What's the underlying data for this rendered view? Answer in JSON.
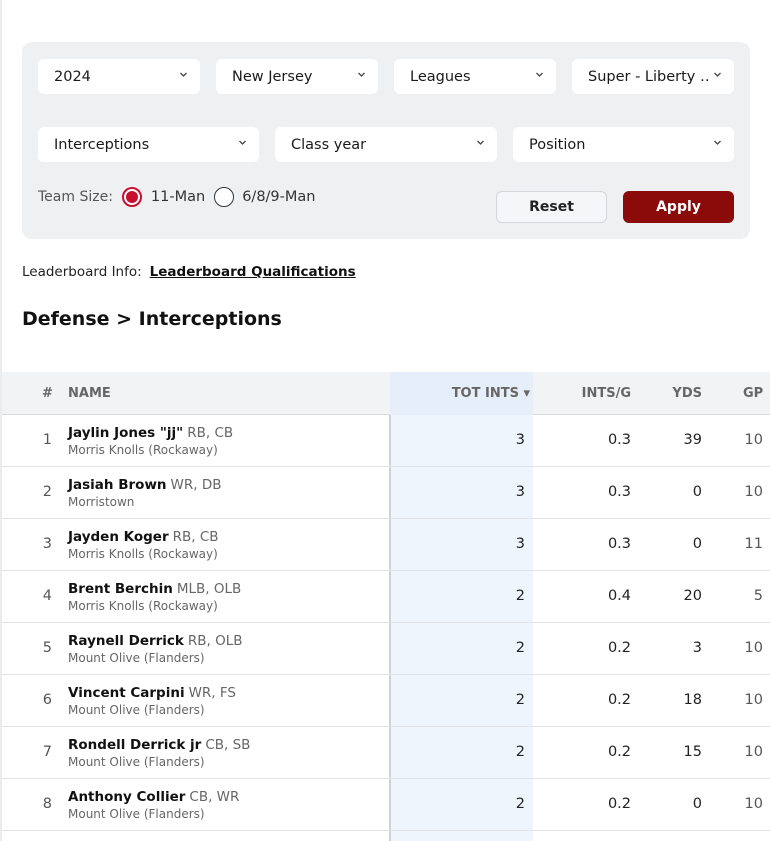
{
  "filters": {
    "year": "2024",
    "state": "New Jersey",
    "leagues": "Leagues",
    "conference": "Super - Liberty …",
    "stat": "Interceptions",
    "class_year": "Class year",
    "position": "Position"
  },
  "team_size": {
    "label": "Team Size:",
    "option_11": "11-Man",
    "option_689": "6/8/9-Man",
    "selected": "11-Man"
  },
  "buttons": {
    "reset": "Reset",
    "apply": "Apply"
  },
  "leaderboard_info": {
    "label": "Leaderboard Info:",
    "link": "Leaderboard Qualifications"
  },
  "section_title": "Defense > Interceptions",
  "table": {
    "headers": {
      "rank": "#",
      "name": "NAME",
      "tot_ints": "TOT INTS ▾",
      "ints_per_game": "INTS/G",
      "yds": "YDS",
      "gp": "GP"
    },
    "rows": [
      {
        "rank": "1",
        "name": "Jaylin Jones \"jj\"",
        "pos": "RB, CB",
        "school": "Morris Knolls (Rockaway)",
        "tot_ints": "3",
        "ints_per_game": "0.3",
        "yds": "39",
        "gp": "10"
      },
      {
        "rank": "2",
        "name": "Jasiah Brown",
        "pos": "WR, DB",
        "school": "Morristown",
        "tot_ints": "3",
        "ints_per_game": "0.3",
        "yds": "0",
        "gp": "10"
      },
      {
        "rank": "3",
        "name": "Jayden Koger",
        "pos": "RB, CB",
        "school": "Morris Knolls (Rockaway)",
        "tot_ints": "3",
        "ints_per_game": "0.3",
        "yds": "0",
        "gp": "11"
      },
      {
        "rank": "4",
        "name": "Brent Berchin",
        "pos": "MLB, OLB",
        "school": "Morris Knolls (Rockaway)",
        "tot_ints": "2",
        "ints_per_game": "0.4",
        "yds": "20",
        "gp": "5"
      },
      {
        "rank": "5",
        "name": "Raynell Derrick",
        "pos": "RB, OLB",
        "school": "Mount Olive (Flanders)",
        "tot_ints": "2",
        "ints_per_game": "0.2",
        "yds": "3",
        "gp": "10"
      },
      {
        "rank": "6",
        "name": "Vincent Carpini",
        "pos": "WR, FS",
        "school": "Mount Olive (Flanders)",
        "tot_ints": "2",
        "ints_per_game": "0.2",
        "yds": "18",
        "gp": "10"
      },
      {
        "rank": "7",
        "name": "Rondell Derrick jr",
        "pos": "CB, SB",
        "school": "Mount Olive (Flanders)",
        "tot_ints": "2",
        "ints_per_game": "0.2",
        "yds": "15",
        "gp": "10"
      },
      {
        "rank": "8",
        "name": "Anthony Collier",
        "pos": "CB, WR",
        "school": "Mount Olive (Flanders)",
        "tot_ints": "2",
        "ints_per_game": "0.2",
        "yds": "0",
        "gp": "10"
      }
    ]
  },
  "colors": {
    "accent": "#c8102e",
    "apply_bg": "#8b0a0a",
    "panel_bg": "#eef0f2",
    "sorted_col_bg": "#eff5fd"
  }
}
